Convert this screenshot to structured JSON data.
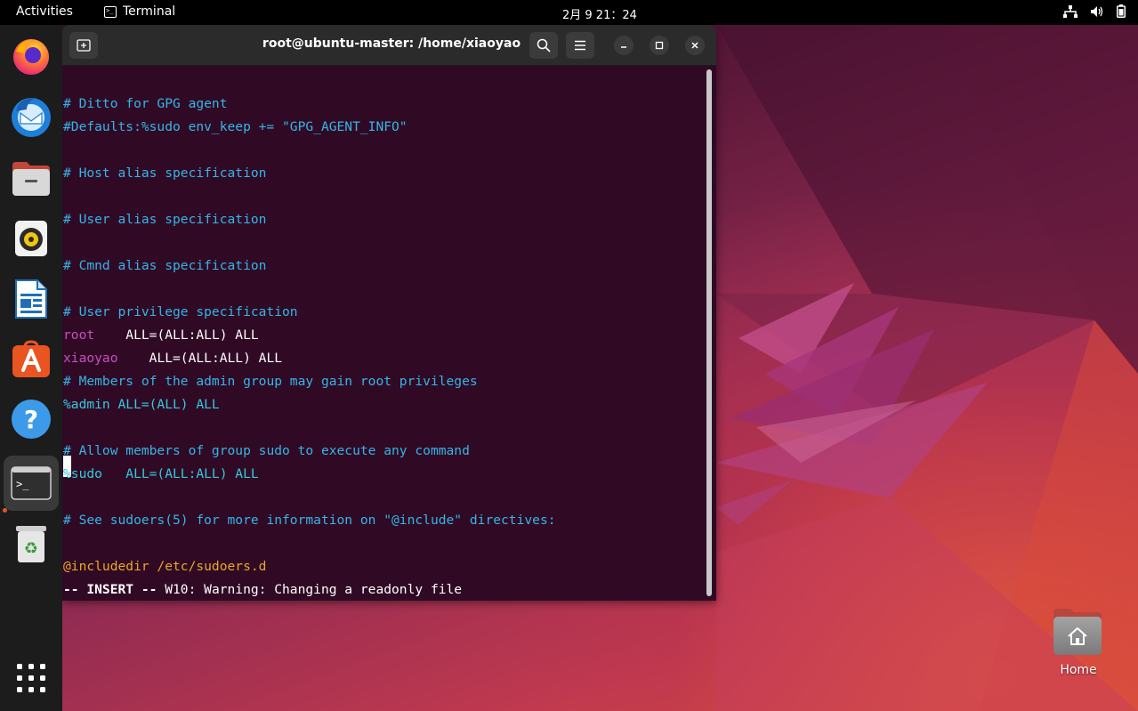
{
  "topbar": {
    "activities": "Activities",
    "app_name": "Terminal",
    "clock": "2月 9  21：24"
  },
  "terminal": {
    "title": "root@ubuntu-master: /home/xiaoyao",
    "lines": {
      "l1": "# Ditto for GPG agent",
      "l2": "#Defaults:%sudo env_keep += \"GPG_AGENT_INFO\"",
      "l4": "# Host alias specification",
      "l6": "# User alias specification",
      "l8": "# Cmnd alias specification",
      "l10": "# User privilege specification",
      "l11_user": "root",
      "l11_rest": "    ALL=(ALL:ALL) ALL",
      "l12_user": "xiaoyao",
      "l12_rest": "    ALL=(ALL:ALL) ALL",
      "l13": "# Members of the admin group may gain root privileges",
      "l14": "%admin ALL=(ALL) ALL",
      "l16": "# Allow members of group sudo to execute any command",
      "l17": "%sudo   ALL=(ALL:ALL) ALL",
      "l19": "# See sudoers(5) for more information on \"@include\" directives:",
      "l21": "@includedir /etc/sudoers.d",
      "status_mode": "-- INSERT --",
      "status_msg": " W10: Warning: Changing a readonly file"
    }
  },
  "desktop": {
    "home_label": "Home"
  },
  "colors": {
    "terminal_bg": "#300a24",
    "comment": "#34b5e8",
    "user": "#c64fbe",
    "include": "#e8a827",
    "accent": "#e95420"
  }
}
